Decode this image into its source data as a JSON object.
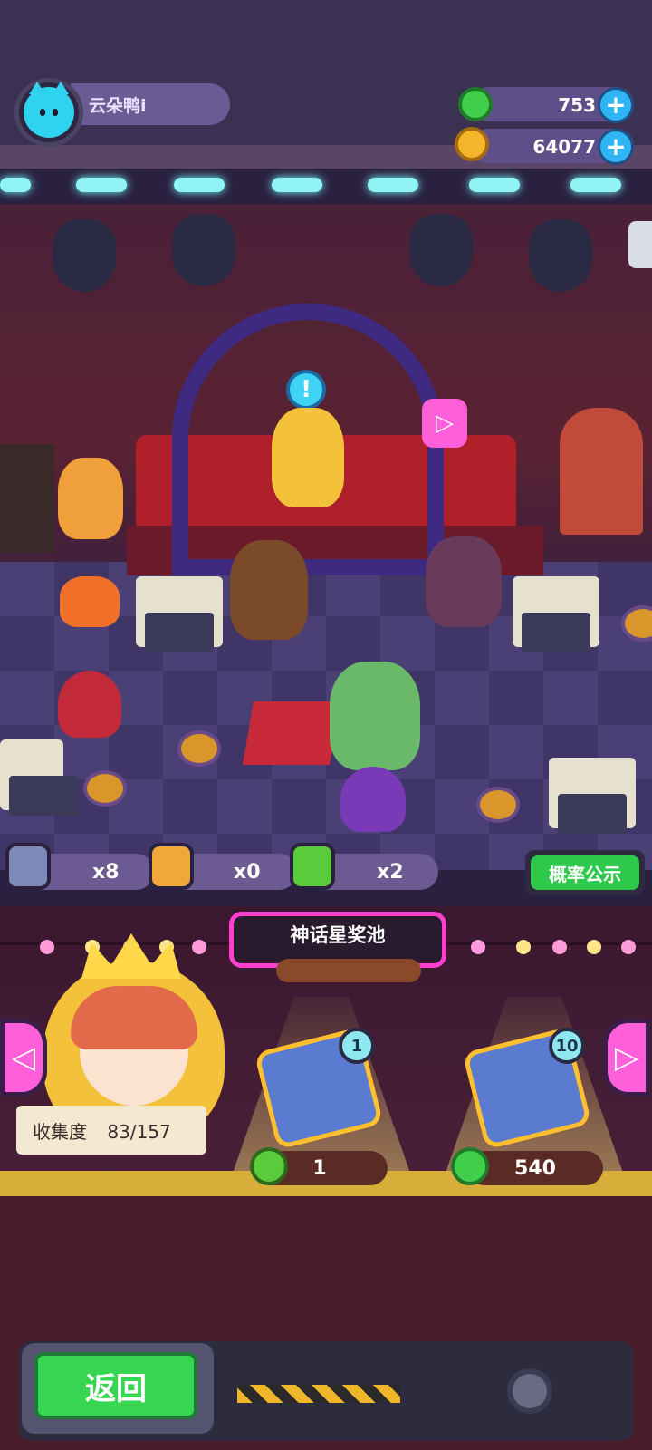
{
  "player": {
    "name": "云朵鸭i"
  },
  "currency": [
    {
      "icon": "green-coin-icon",
      "value": "753"
    },
    {
      "icon": "gold-planet-icon",
      "value": "64077"
    }
  ],
  "items": [
    {
      "icon": "blue-cap-icon",
      "count": "x8"
    },
    {
      "icon": "orange-cap-icon",
      "count": "x0"
    },
    {
      "icon": "green-cap-icon",
      "count": "x2"
    }
  ],
  "buttons": {
    "probability": "概率公示",
    "back": "返回",
    "prev": "◁",
    "next": "▷"
  },
  "pool": {
    "title": "神话星奖池"
  },
  "collection": {
    "label": "收集度",
    "value": "83/157"
  },
  "draws": [
    {
      "badge": "1",
      "price": "1",
      "price_icon": "green-cap-icon"
    },
    {
      "badge": "10",
      "price": "540",
      "price_icon": "green-coin-icon"
    }
  ],
  "colors": {
    "accent_pink": "#ff3fd0",
    "button_green": "#2ec94a",
    "coin_green": "#3fcf4a",
    "gold": "#f4c23a"
  }
}
